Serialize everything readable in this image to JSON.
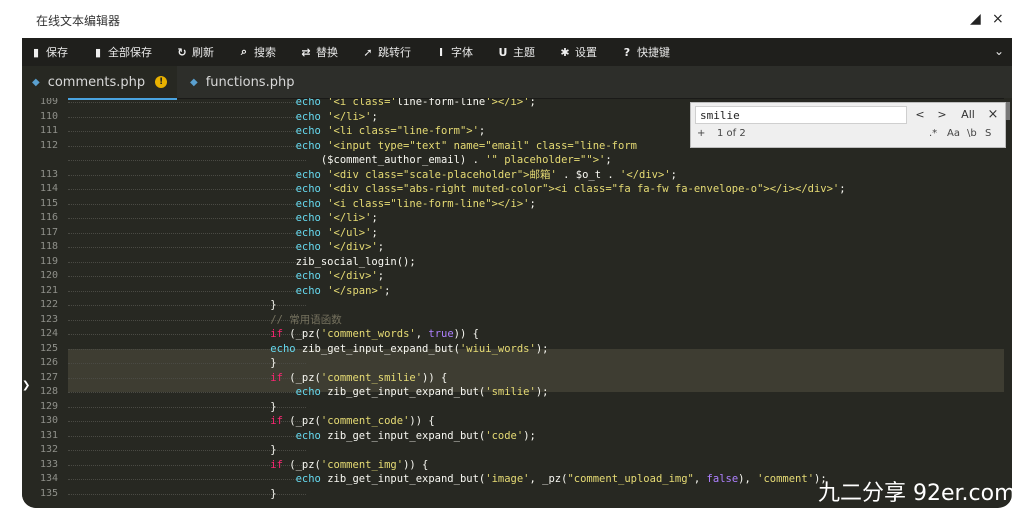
{
  "window": {
    "title": "在线文本编辑器",
    "restore_glyph": "◢",
    "close_glyph": "×"
  },
  "toolbar": {
    "items": [
      {
        "icon": "save-icon",
        "glyph": "▮",
        "label": "保存"
      },
      {
        "icon": "save-all-icon",
        "glyph": "▮",
        "label": "全部保存"
      },
      {
        "icon": "refresh-icon",
        "glyph": "↻",
        "label": "刷新"
      },
      {
        "icon": "search-icon",
        "glyph": "⌕",
        "label": "搜索"
      },
      {
        "icon": "replace-icon",
        "glyph": "⇄",
        "label": "替换"
      },
      {
        "icon": "goto-line-icon",
        "glyph": "➚",
        "label": "跳转行"
      },
      {
        "icon": "font-icon",
        "glyph": "I",
        "label": "字体"
      },
      {
        "icon": "theme-icon",
        "glyph": "U",
        "label": "主题"
      },
      {
        "icon": "settings-icon",
        "glyph": "✱",
        "label": "设置"
      },
      {
        "icon": "shortcut-icon",
        "glyph": "?",
        "label": "快捷键"
      }
    ],
    "collapse_glyph": "⌄"
  },
  "tabs": [
    {
      "label": "comments.php",
      "active": true,
      "badge": "!"
    },
    {
      "label": "functions.php",
      "active": false
    }
  ],
  "search": {
    "value": "smilie",
    "prev": "<",
    "next": ">",
    "all": "All",
    "close": "×",
    "add": "+",
    "count": "1 of 2",
    "opt_regex": ".*",
    "opt_case": "Aa",
    "opt_word": "\\b",
    "opt_sel": "S"
  },
  "code": {
    "line_numbers": [
      "109",
      "110",
      "111",
      "112",
      "",
      "113",
      "114",
      "115",
      "116",
      "117",
      "118",
      "119",
      "120",
      "121",
      "122",
      "123",
      "124",
      "125",
      "126",
      "127",
      "128",
      "129",
      "130",
      "131",
      "132",
      "133",
      "134",
      "135"
    ],
    "lines": [
      "                                    echo '<i class='line-form-line'></i>';",
      "                                    echo '</li>';",
      "                                    echo '<li class=\"line-form\">';",
      "                                    echo '<input type=\"text\" name=\"email\" class=\"line-form",
      "                                        ($comment_author_email) . '\" placeholder=\"\">';",
      "                                    echo '<div class=\"scale-placeholder\">邮箱' . $o_t . '</div>';",
      "                                    echo '<div class=\"abs-right muted-color\"><i class=\"fa fa-fw fa-envelope-o\"></i></div>';",
      "                                    echo '<i class=\"line-form-line\"></i>';",
      "                                    echo '</li>';",
      "                                    echo '</ul>';",
      "                                    echo '</div>';",
      "                                    zib_social_login();",
      "                                    echo '</div>';",
      "                                    echo '</span>';",
      "                                }",
      "                                // 常用语函数",
      "                                if (_pz('comment_words', true)) {",
      "                                echo zib_get_input_expand_but('wiui_words');",
      "                                }",
      "                                if (_pz('comment_smilie')) {",
      "                                    echo zib_get_input_expand_but('smilie');",
      "                                }",
      "                                if (_pz('comment_code')) {",
      "                                    echo zib_get_input_expand_but('code');",
      "                                }",
      "                                if (_pz('comment_img')) {",
      "                                    echo zib_get_input_expand_but('image', _pz(\"comment_upload_img\", false), 'comment');",
      "                                }"
    ]
  },
  "watermark": "九二分享 92er.com",
  "colors": {
    "editor_bg": "#272822",
    "keyword": "#66d9ef",
    "control": "#f92672",
    "string": "#e6db74",
    "comment": "#75715e",
    "highlight": "#3e3d32"
  }
}
